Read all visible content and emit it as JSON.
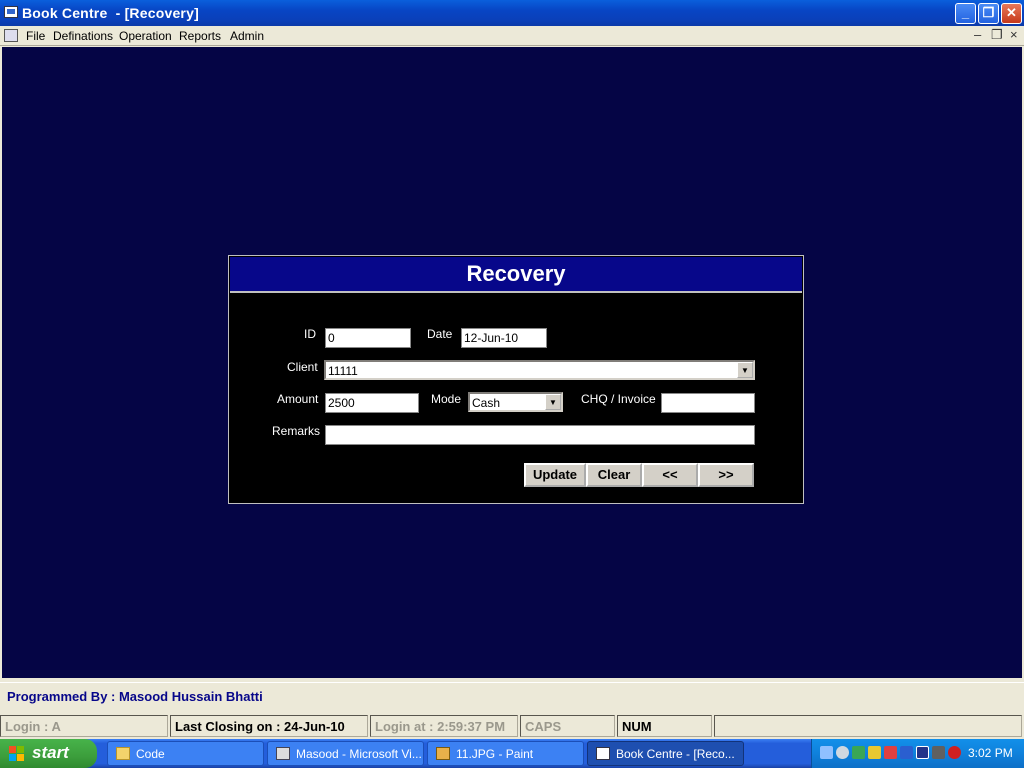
{
  "window": {
    "title": "Book Centre  - [Recovery]",
    "controls": {
      "minimize": "_",
      "restore": "❐",
      "close": "✕"
    }
  },
  "menu": {
    "items": [
      "File",
      "Definations",
      "Operation",
      "Reports",
      "Admin"
    ],
    "mdi_controls": {
      "minimize": "–",
      "restore": "❐",
      "close": "×"
    }
  },
  "dialog": {
    "title": "Recovery",
    "labels": {
      "id": "ID",
      "date": "Date",
      "client": "Client",
      "amount": "Amount",
      "mode": "Mode",
      "chq": "CHQ / Invoice",
      "remarks": "Remarks"
    },
    "values": {
      "id": "0",
      "date": "12-Jun-10",
      "client": "11111",
      "amount": "2500",
      "mode": "Cash",
      "chq": "",
      "remarks": ""
    },
    "buttons": {
      "update": "Update",
      "clear": "Clear",
      "prev": "<<",
      "next": ">>"
    }
  },
  "status": {
    "programmed_by": "Programmed By : Masood Hussain Bhatti",
    "login": "Login :  A",
    "last_closing": "Last Closing on : 24-Jun-10",
    "login_at": "Login at : 2:59:37 PM",
    "caps": "CAPS",
    "num": "NUM"
  },
  "taskbar": {
    "start_label": "start",
    "tasks": [
      {
        "label": "Code",
        "icon": "folder-icon",
        "active": false
      },
      {
        "label": "Masood - Microsoft Vi...",
        "icon": "visual-basic-icon",
        "active": false
      },
      {
        "label": "11.JPG - Paint",
        "icon": "paint-icon",
        "active": false
      },
      {
        "label": "Book Centre  - [Reco...",
        "icon": "app-window-icon",
        "active": true
      }
    ],
    "clock": "3:02 PM"
  },
  "colors": {
    "workspace": "#050545",
    "dialog_header": "#07078a",
    "status_text": "#07078a"
  }
}
